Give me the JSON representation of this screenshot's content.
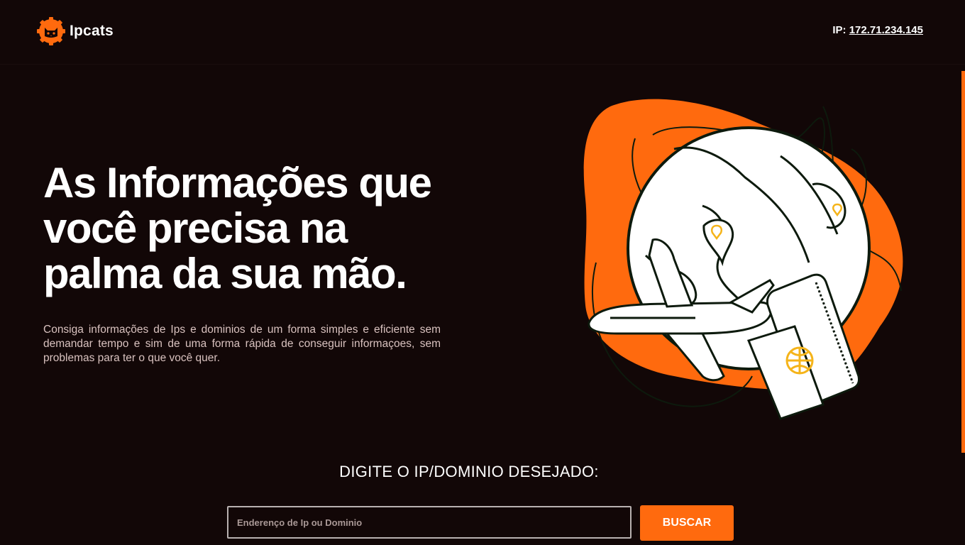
{
  "header": {
    "logo_text": "Ipcats",
    "ip_label": "IP:",
    "ip_value": "172.71.234.145"
  },
  "hero": {
    "title_lines": [
      "As Informações que",
      "você precisa na",
      "palma da sua mão."
    ],
    "description": "Consiga informações de Ips e dominios de um forma simples e eficiente sem demandar tempo e sim de uma forma rápida de conseguir informaçoes, sem problemas para ter o que você quer."
  },
  "search": {
    "label": "DIGITE O IP/DOMINIO DESEJADO:",
    "placeholder": "Enderenço de Ip ou Dominio",
    "value": "",
    "button_label": "BUSCAR"
  },
  "colors": {
    "background": "#120707",
    "accent": "#ff6a0e",
    "text": "#ffffff",
    "muted_text": "#d9c2bf"
  },
  "icons": {
    "logo": "cat-gear-icon",
    "illustration": "globe-airplane-passport-illustration"
  }
}
